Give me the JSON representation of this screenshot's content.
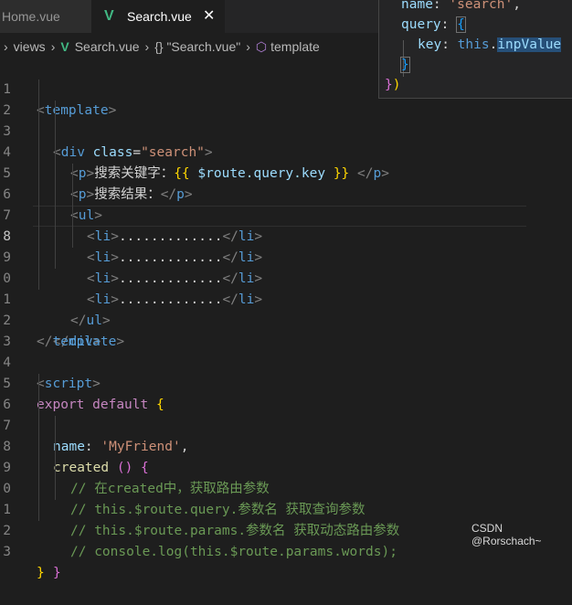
{
  "tabs": [
    {
      "label": "Home.vue",
      "active": false
    },
    {
      "label": "Search.vue",
      "active": true,
      "close": "✕"
    }
  ],
  "breadcrumb": {
    "folder": "views",
    "file": "Search.vue",
    "object": "{} \"Search.vue\"",
    "node": "template"
  },
  "line_numbers": [
    "1",
    "2",
    "3",
    "4",
    "5",
    "6",
    "7",
    "8",
    "9",
    "0",
    "1",
    "2",
    "3",
    "4",
    "5",
    "6",
    "7",
    "8",
    "9",
    "0",
    "1",
    "2",
    "3"
  ],
  "current_line_index": 7,
  "code": {
    "template_open": "template",
    "div_tag": "div",
    "class_attr": "class",
    "class_value": "\"search\"",
    "p_tag": "p",
    "search_keyword_label": "搜索关键字：",
    "mustache_open": "{{",
    "route_query_key": " $route.query.key ",
    "mustache_close": "}}",
    "search_result_label": "搜索结果：",
    "ul_tag": "ul",
    "li_tag": "li",
    "li_text": ".............",
    "template_close": "template",
    "script_tag": "script",
    "export_kw": "export",
    "default_kw": "default",
    "name_key": "name",
    "name_value": "'MyFriend'",
    "created_fn": "created",
    "comment_1": "// 在created中，获取路由参数",
    "comment_2": "// this.$route.query.参数名 获取查询参数",
    "comment_3": "// this.$route.params.参数名 获取动态路由参数",
    "comment_4": "// console.log(this.$route.params.words);"
  },
  "hover_panel": {
    "name_key": "name",
    "name_value": "'search'",
    "query_key": "query",
    "key_key": "key",
    "this_kw": "this",
    "inp_value": "inpValue"
  },
  "watermark": "CSDN @Rorschach~",
  "colors": {
    "background": "#1e1e1e",
    "tag": "#569cd6",
    "keyword": "#c586c0",
    "string": "#ce9178",
    "comment": "#6a9955",
    "vue_green": "#41b883"
  }
}
